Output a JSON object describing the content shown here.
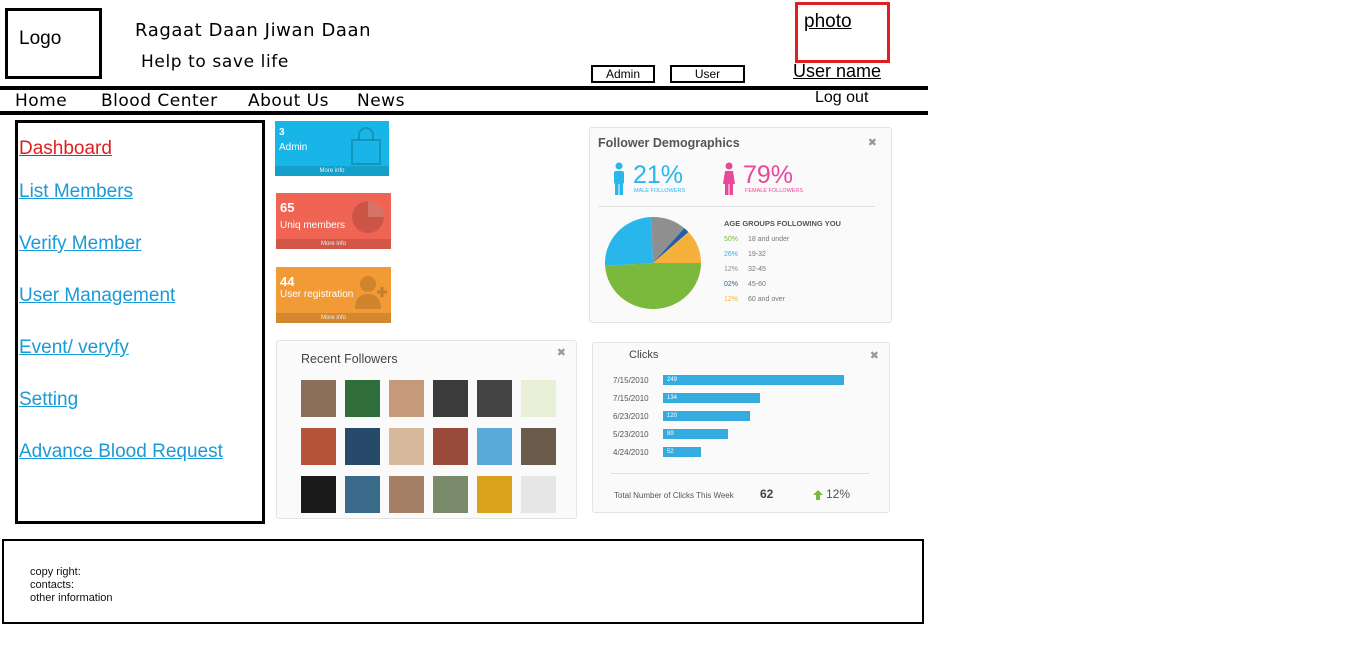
{
  "header": {
    "logo": "Logo",
    "site_title": "Ragaat Daan Jiwan Daan",
    "tagline": "Help to save life",
    "admin_btn": "Admin",
    "user_btn": "User",
    "photo": "photo",
    "user_name": "User name",
    "logout": "Log out"
  },
  "nav": [
    "Home",
    "Blood Center",
    "About Us",
    "News"
  ],
  "sidebar": {
    "items": [
      {
        "label": "Dashboard",
        "active": true
      },
      {
        "label": "List Members"
      },
      {
        "label": "Verify Member"
      },
      {
        "label": "User Management"
      },
      {
        "label": "Event/ veryfy"
      },
      {
        "label": "Setting"
      },
      {
        "label": "Advance Blood Request"
      }
    ]
  },
  "tiles": [
    {
      "value": "3",
      "label": "Admin",
      "more": "More info",
      "color": "#18b6e8"
    },
    {
      "value": "65",
      "label": "Uniq members",
      "more": "More info",
      "color": "#ef6453"
    },
    {
      "value": "44",
      "label": "User registration",
      "more": "More info",
      "color": "#f29a35"
    }
  ],
  "demographics": {
    "title": "Follower Demographics",
    "male_pct": "21%",
    "male_label": "MALE FOLLOWERS",
    "female_pct": "79%",
    "female_label": "FEMALE FOLLOWERS",
    "age_title": "AGE GROUPS FOLLOWING YOU",
    "age_groups": [
      {
        "pct": "50%",
        "label": "18 and under",
        "color": "#7ab93c",
        "value": 50
      },
      {
        "pct": "26%",
        "label": "19-32",
        "color": "#29b6ea",
        "value": 26
      },
      {
        "pct": "12%",
        "label": "32-45",
        "color": "#8f8f8f",
        "value": 12
      },
      {
        "pct": "02%",
        "label": "45-60",
        "color": "#235fa8",
        "value": 2
      },
      {
        "pct": "12%",
        "label": "60 and over",
        "color": "#f6b13d",
        "value": 12
      }
    ]
  },
  "followers": {
    "title": "Recent Followers"
  },
  "clicks": {
    "title": "Clicks",
    "rows": [
      {
        "date": "7/15/2010",
        "value": 249
      },
      {
        "date": "7/15/2010",
        "value": 134
      },
      {
        "date": "6/23/2010",
        "value": 120
      },
      {
        "date": "5/23/2010",
        "value": 89
      },
      {
        "date": "4/24/2010",
        "value": 52
      }
    ],
    "total_label": "Total Number of Clicks This Week",
    "total_value": "62",
    "change": "12%"
  },
  "footer": {
    "copyright": "copy right:",
    "contacts": "contacts:",
    "other": "other information"
  }
}
